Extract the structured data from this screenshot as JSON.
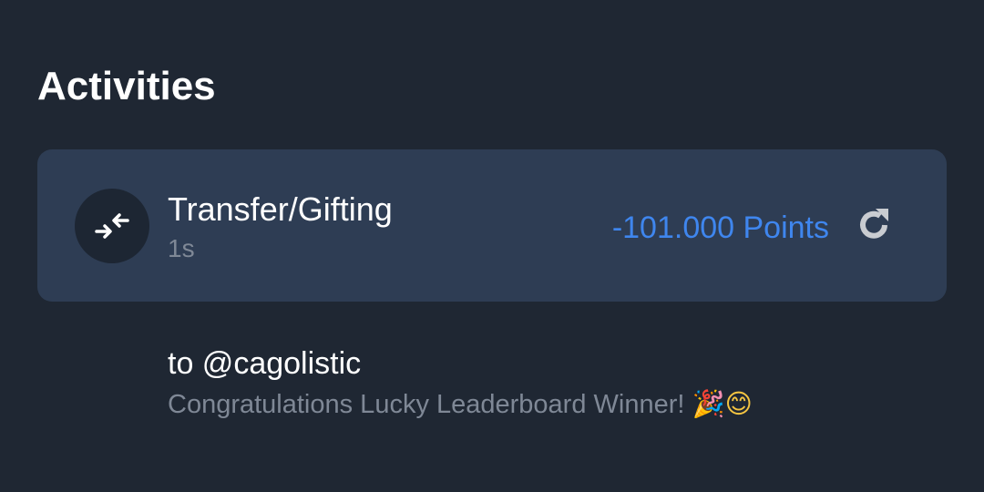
{
  "header": {
    "title": "Activities"
  },
  "activity": {
    "type_label": "Transfer/Gifting",
    "time_ago": "1s",
    "amount": "-101.000 Points",
    "amount_color": "#3f86ee",
    "icon": "transfer-arrows-icon",
    "action_icon": "refresh-icon",
    "recipient": "to @cagolistic",
    "message": "Congratulations Lucky Leaderboard Winner! ",
    "message_emoji": "🎉😊"
  },
  "colors": {
    "background": "#1f2733",
    "card": "#2e3d54",
    "muted_text": "#7f8896"
  }
}
